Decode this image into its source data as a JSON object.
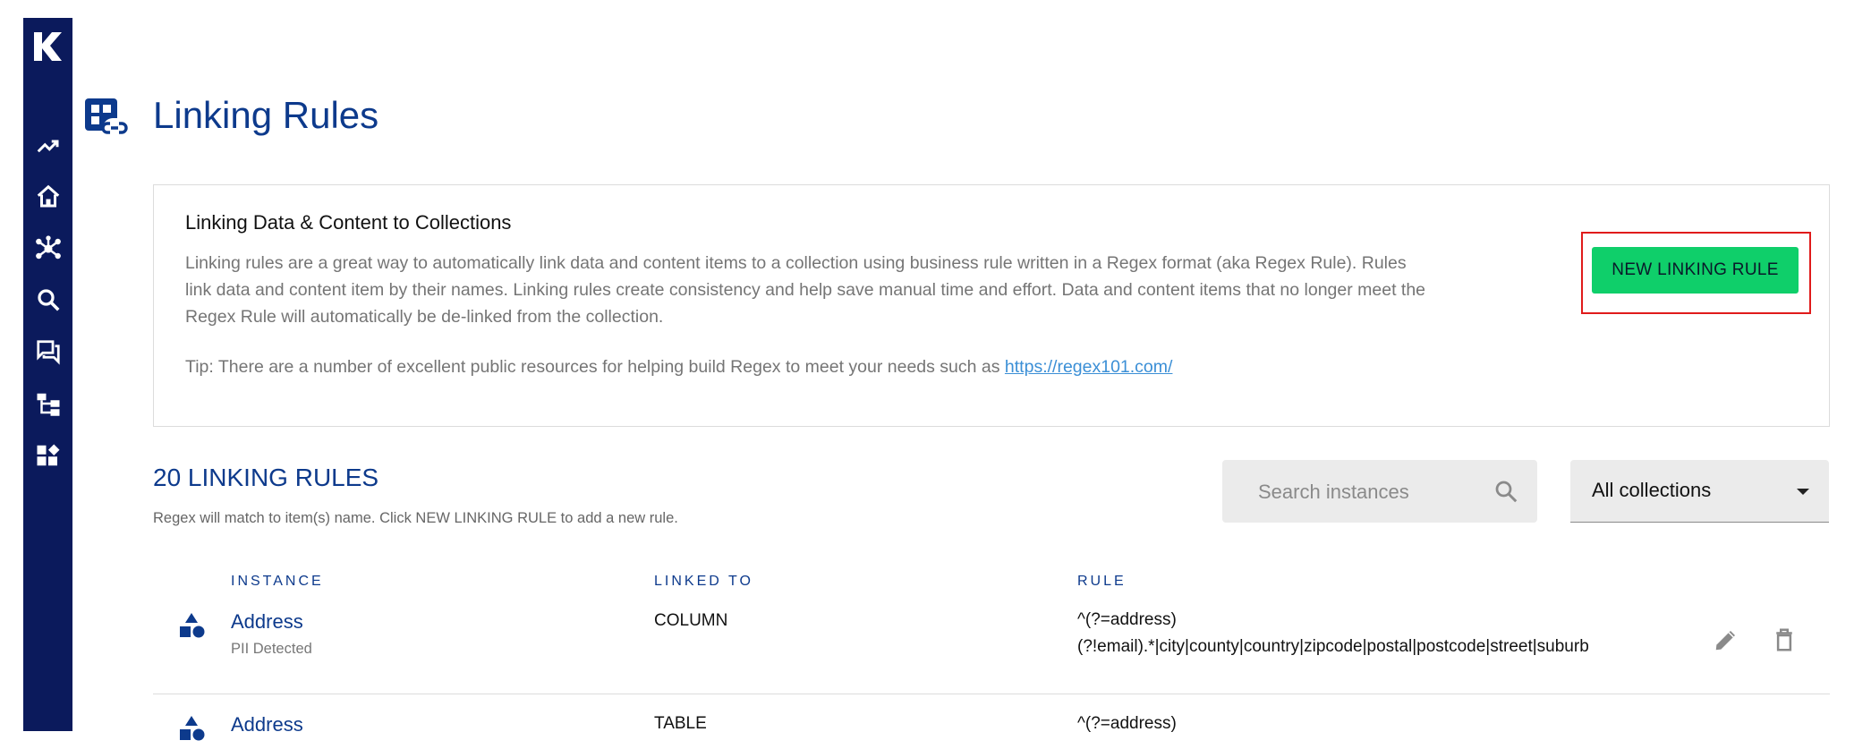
{
  "colors": {
    "sidebar_bg": "#0b1a5c",
    "brand_blue": "#0d3a8c",
    "primary_button": "#0fcf6a",
    "highlight": "#e01b1b",
    "link": "#3b8fd6"
  },
  "sidebar": {
    "logo": "k-logo",
    "items": [
      {
        "icon": "trending-up-icon"
      },
      {
        "icon": "home-icon"
      },
      {
        "icon": "network-icon"
      },
      {
        "icon": "search-icon"
      },
      {
        "icon": "forum-icon"
      },
      {
        "icon": "hierarchy-icon"
      },
      {
        "icon": "dashboard-icon"
      }
    ]
  },
  "page": {
    "icon": "linking-rules-icon",
    "title": "Linking Rules"
  },
  "info_card": {
    "heading": "Linking Data & Content to Collections",
    "description": "Linking rules are a great way to automatically link data and content items to a collection using business rule written in a Regex format (aka Regex Rule). Rules link data and content item by their names. Linking rules create consistency and help save manual time and effort. Data and content items that no longer meet the Regex Rule will automatically be de-linked from the collection.",
    "tip_prefix": "Tip: There are a number of excellent public resources for helping build Regex to meet your needs such as ",
    "tip_link": "https://regex101.com/",
    "new_button_label": "NEW LINKING RULE"
  },
  "rules_section": {
    "count_title": "20 LINKING RULES",
    "subtitle": "Regex will match to item(s) name. Click NEW LINKING RULE to add a new rule.",
    "search_placeholder": "Search instances",
    "collection_filter": "All collections"
  },
  "table": {
    "columns": [
      "INSTANCE",
      "LINKED TO",
      "RULE"
    ],
    "rows": [
      {
        "icon": "shapes-icon",
        "instance": "Address",
        "instance_sub": "PII Detected",
        "linked_to": "COLUMN",
        "rule_line1": "^(?=address)",
        "rule_line2": "(?!email).*|city|county|country|zipcode|postal|postcode|street|suburb"
      },
      {
        "icon": "shapes-icon",
        "instance": "Address",
        "instance_sub": "",
        "linked_to": "TABLE",
        "rule_line1": "^(?=address)",
        "rule_line2": ""
      }
    ]
  }
}
